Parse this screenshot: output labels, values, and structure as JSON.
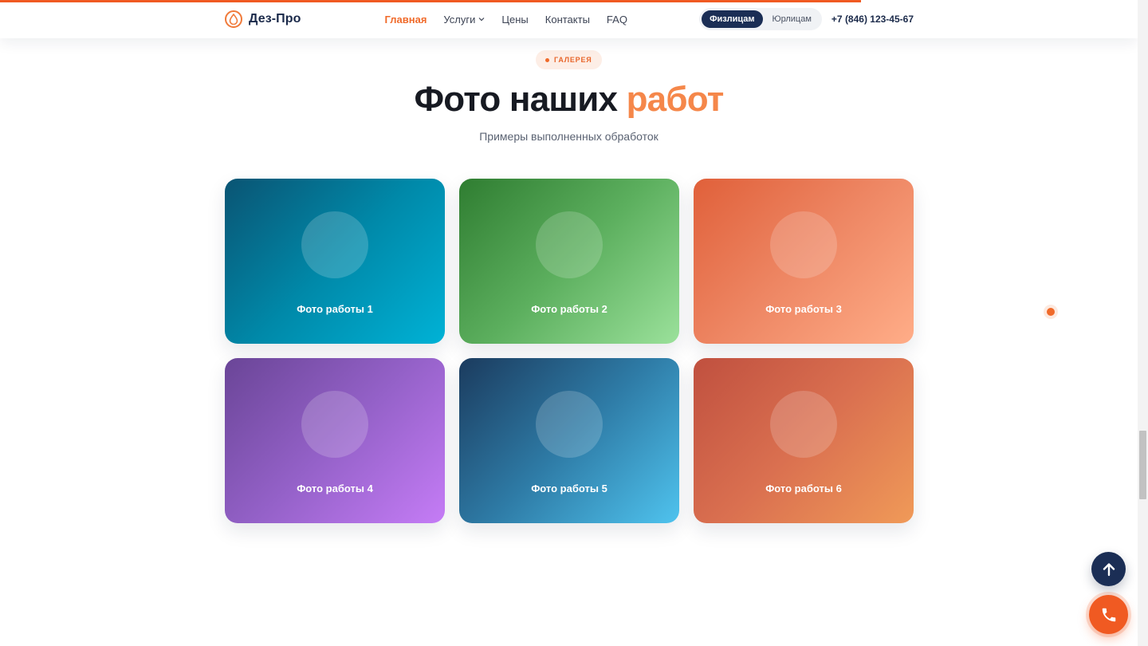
{
  "header": {
    "brand": "Дез-Про",
    "nav": [
      {
        "label": "Главная",
        "active": true
      },
      {
        "label": "Услуги",
        "dropdown": true
      },
      {
        "label": "Цены"
      },
      {
        "label": "Контакты"
      },
      {
        "label": "FAQ"
      }
    ],
    "audience": {
      "options": [
        "Физлицам",
        "Юрлицам"
      ],
      "selected": "Физлицам"
    },
    "phone": "+7 (846) 123-45-67"
  },
  "page": {
    "scroll_progress_fraction": 0.75
  },
  "section": {
    "badge": "ГАЛЕРЕЯ",
    "title_main": "Фото наших",
    "title_accent": "работ",
    "subtitle": "Примеры выполненных обработок"
  },
  "gallery": [
    {
      "label": "Фото работы 1"
    },
    {
      "label": "Фото работы 2"
    },
    {
      "label": "Фото работы 3"
    },
    {
      "label": "Фото работы 4"
    },
    {
      "label": "Фото работы 5"
    },
    {
      "label": "Фото работы 6"
    }
  ],
  "actions": {
    "scroll_top_icon": "arrow-up-icon",
    "call_icon": "phone-icon"
  },
  "colors": {
    "accent": "#f05a22",
    "navy": "#1b2e55"
  }
}
